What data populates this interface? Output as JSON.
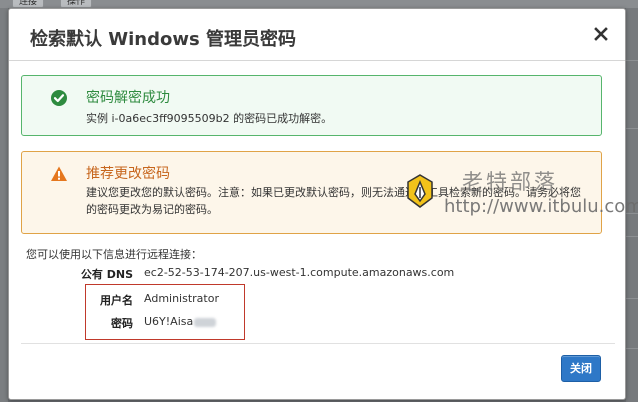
{
  "background": {
    "tabs": [
      "连接",
      "操作"
    ]
  },
  "dialog": {
    "title": "检索默认 Windows 管理员密码",
    "close_icon": "close-icon"
  },
  "success_alert": {
    "icon": "check-circle-icon",
    "title": "密码解密成功",
    "message": "实例 i-0a6ec3ff9095509b2 的密码已成功解密。"
  },
  "warning_alert": {
    "icon": "warning-triangle-icon",
    "title": "推荐更改密码",
    "line1": "建议您更改您的默认密码。注意：如果已更改默认密码，则无法通过该工具检索新的密码。请务必将您",
    "line2": "的密码更改为易记的密码。"
  },
  "watermark": {
    "name": "老特部落",
    "url": "http://www.itbulu.com"
  },
  "connection": {
    "intro": "您可以使用以下信息进行远程连接：",
    "dns_label": "公有 DNS",
    "dns_value": "ec2-52-53-174-207.us-west-1.compute.amazonaws.com",
    "user_label": "用户名",
    "user_value": "Administrator",
    "password_label": "密码",
    "password_value": "U6Y!Aisa"
  },
  "footer": {
    "close_button": "关闭"
  },
  "colors": {
    "success": "#2e8b3f",
    "warning": "#c7661d",
    "primary_button": "#2e78c7",
    "highlight_box": "#c0392b"
  }
}
